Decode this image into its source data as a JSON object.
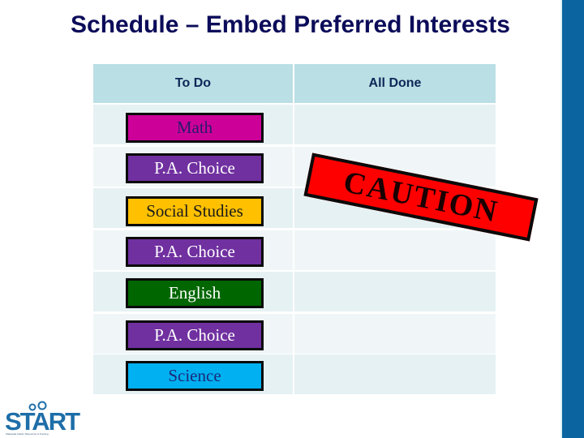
{
  "title": "Schedule – Embed Preferred Interests",
  "table": {
    "headers": [
      "To Do",
      "All Done"
    ],
    "rows": [
      {
        "label": "Math",
        "bg": "#cc0099",
        "color": "#2a1a6a"
      },
      {
        "label": "P.A. Choice",
        "bg": "#7030a0",
        "color": "#ffffff"
      },
      {
        "label": "Social Studies",
        "bg": "#ffc000",
        "color": "#1a1a1a"
      },
      {
        "label": "P.A. Choice",
        "bg": "#7030a0",
        "color": "#ffffff"
      },
      {
        "label": "English",
        "bg": "#006600",
        "color": "#ffffff"
      },
      {
        "label": "P.A. Choice",
        "bg": "#7030a0",
        "color": "#ffffff"
      },
      {
        "label": "Science",
        "bg": "#00b0f0",
        "color": "#1a2a7a"
      }
    ]
  },
  "caution": {
    "label": "CAUTION",
    "bg": "#ff0000"
  },
  "logo": {
    "name": "START",
    "tagline": "Statewide Autism Resources & Training"
  },
  "colors": {
    "accent_bar": "#0b64a0",
    "title": "#0c0c5a",
    "header_bg": "#badfe4"
  }
}
